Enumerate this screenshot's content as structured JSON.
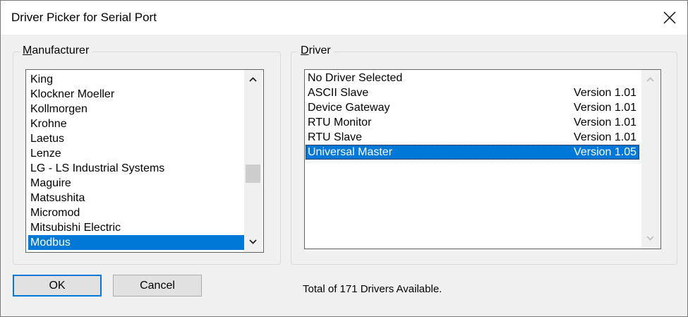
{
  "window": {
    "title": "Driver Picker for Serial Port"
  },
  "manufacturer": {
    "label_prefix": "",
    "label_access_key": "M",
    "label_rest": "anufacturer",
    "items": [
      {
        "label": "King"
      },
      {
        "label": "Klockner Moeller"
      },
      {
        "label": "Kollmorgen"
      },
      {
        "label": "Krohne"
      },
      {
        "label": "Laetus"
      },
      {
        "label": "Lenze"
      },
      {
        "label": "LG - LS Industrial Systems"
      },
      {
        "label": "Maguire"
      },
      {
        "label": "Matsushita"
      },
      {
        "label": "Micromod"
      },
      {
        "label": "Mitsubishi Electric"
      },
      {
        "label": "Modbus"
      }
    ],
    "selected": "Modbus"
  },
  "driver": {
    "label_access_key": "D",
    "label_rest": "river",
    "items": [
      {
        "name": "No Driver Selected",
        "version": ""
      },
      {
        "name": "ASCII Slave",
        "version": "Version 1.01"
      },
      {
        "name": "Device Gateway",
        "version": "Version 1.01"
      },
      {
        "name": "RTU Monitor",
        "version": "Version 1.01"
      },
      {
        "name": "RTU Slave",
        "version": "Version 1.01"
      },
      {
        "name": "Universal Master",
        "version": "Version 1.05"
      }
    ],
    "selected": "Universal Master"
  },
  "buttons": {
    "ok": "OK",
    "cancel": "Cancel"
  },
  "status_text": "Total of 171 Drivers Available.",
  "icons": {
    "close": "close-icon",
    "scroll_up": "chevron-up-icon",
    "scroll_down": "chevron-down-icon"
  },
  "colors": {
    "selection": "#0078d7",
    "default_button_border": "#0078d7",
    "window_background": "#f0f0f0"
  }
}
